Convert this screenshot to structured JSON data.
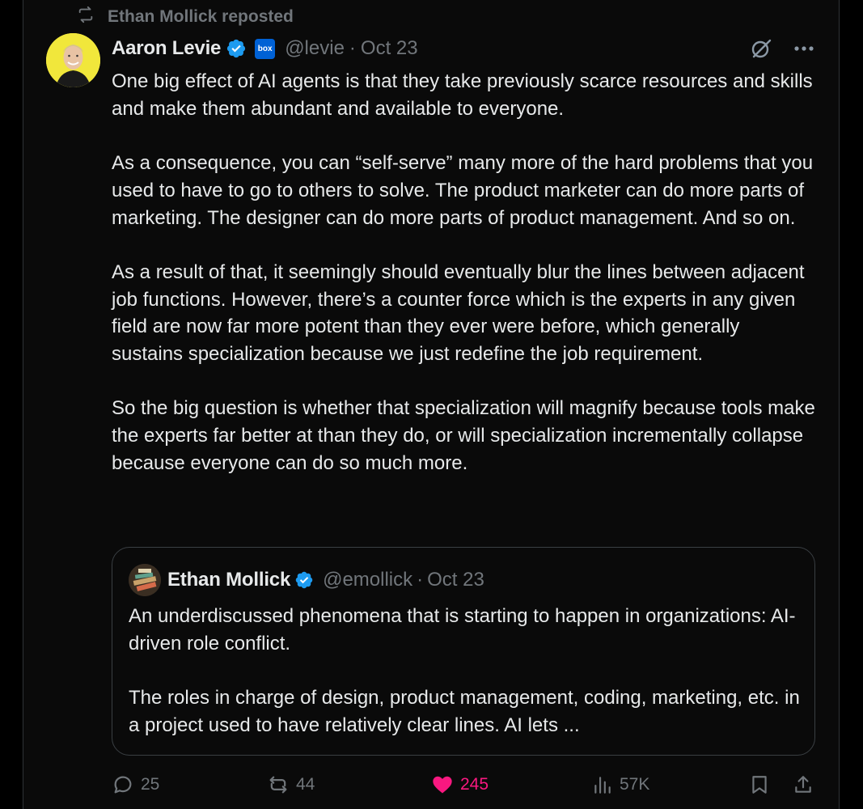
{
  "repost": {
    "label": "Ethan Mollick reposted"
  },
  "post": {
    "author_name": "Aaron Levie",
    "handle": "@levie",
    "separator": "·",
    "date": "Oct 23",
    "badge_text": "box",
    "text": "One big effect of AI agents is that they take previously scarce resources and skills and make them abundant and available to everyone.\n\nAs a consequence, you can “self-serve” many more of the hard problems that you used to have to go to others to solve. The product marketer can do more parts of marketing. The designer can do more parts of product management. And so on.\n\nAs a result of that, it seemingly should eventually blur the lines between adjacent job functions. However, there’s a counter force which is the experts in any given field are now far more potent than they ever were before, which generally sustains specialization because we just redefine the job requirement.\n\nSo the big question is whether that specialization will magnify because tools make the experts far better at than they do, or will specialization incrementally collapse because everyone can do so much more."
  },
  "quote": {
    "author_name": "Ethan Mollick",
    "handle": "@emollick",
    "separator": "·",
    "date": "Oct 23",
    "text": "An underdiscussed phenomena that is starting to happen in organizations: AI-driven role conflict.\n\nThe roles in charge of design, product management, coding, marketing, etc. in a project used to have relatively clear lines. AI lets ..."
  },
  "actions": {
    "replies": "25",
    "reposts": "44",
    "likes": "245",
    "views": "57K"
  },
  "colors": {
    "background": "#0a0a0a",
    "text": "#e7e9ea",
    "muted": "#71767b",
    "verified": "#1d9bf0",
    "like": "#f91880",
    "box_brand": "#0061d5",
    "avatar_bg": "#f1e73b"
  },
  "icons": [
    "repost-icon",
    "verified-icon",
    "grok-icon",
    "more-icon",
    "reply-icon",
    "heart-icon",
    "views-icon",
    "bookmark-icon",
    "share-icon"
  ]
}
